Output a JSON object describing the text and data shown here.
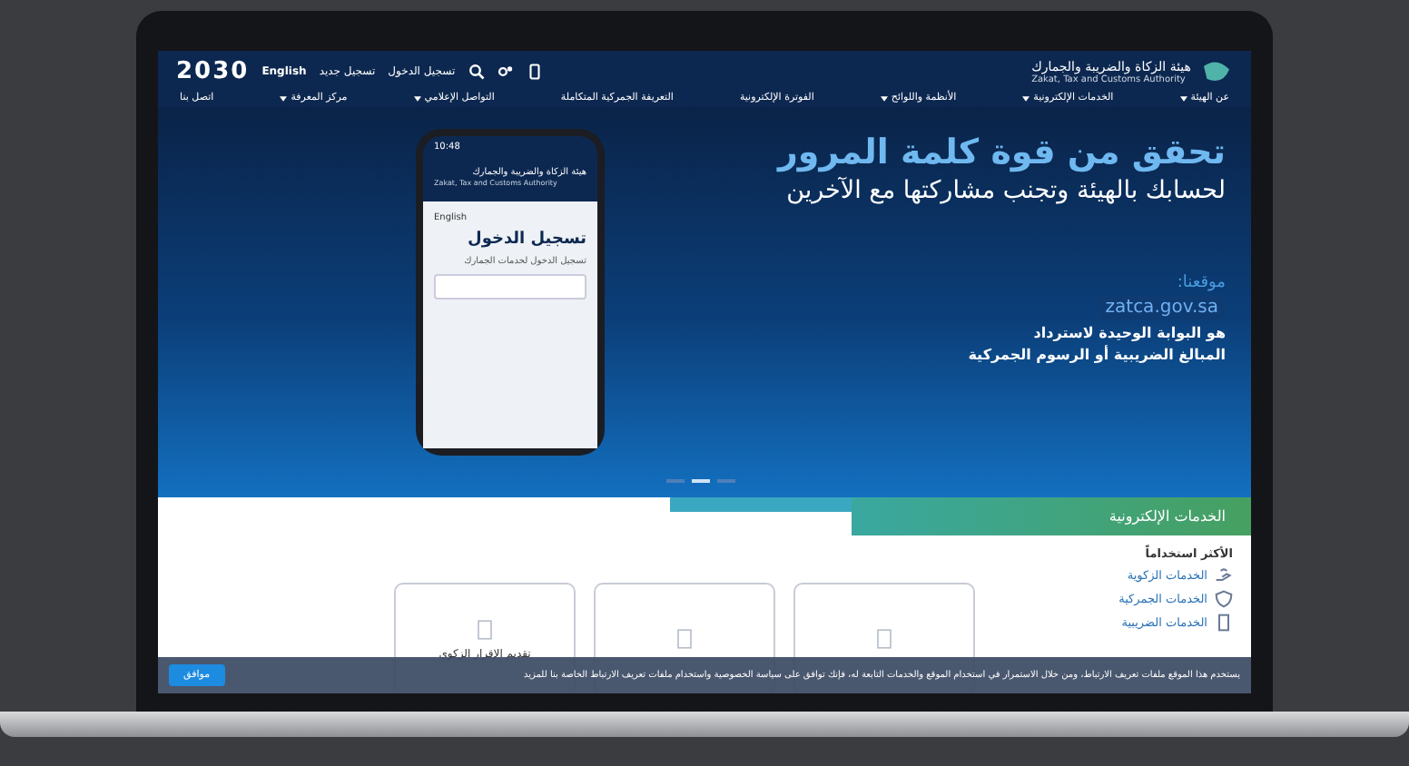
{
  "header": {
    "vision_logo": "2030",
    "language": "English",
    "register": "تسجيل جديد",
    "login": "تسجيل الدخول",
    "org_name_ar": "هيئة الزكاة والضريبة والجمارك",
    "org_name_en": "Zakat, Tax and Customs Authority"
  },
  "nav": [
    {
      "label": "عن الهيئة",
      "has_menu": true
    },
    {
      "label": "الخدمات الإلكترونية",
      "has_menu": true
    },
    {
      "label": "الأنظمة واللوائح",
      "has_menu": true
    },
    {
      "label": "الفوترة الإلكترونية",
      "has_menu": false
    },
    {
      "label": "التعريفة الجمركية المتكاملة",
      "has_menu": false
    },
    {
      "label": "التواصل الإعلامي",
      "has_menu": true
    },
    {
      "label": "مركز المعرفة",
      "has_menu": true
    },
    {
      "label": "اتصل بنا",
      "has_menu": false
    }
  ],
  "hero": {
    "title": "تحقق من قوة كلمة المرور",
    "subtitle": "لحسابك بالهيئة وتجنب مشاركتها مع الآخرين",
    "site_label": "موقعنا:",
    "site": "zatca.gov.sa",
    "desc_lines": [
      "هو البوابة الوحيدة لاسترداد",
      "المبالغ الضريبية أو الرسوم الجمركية"
    ],
    "phone": {
      "time": "10:48",
      "org_name_ar": "هيئة الزكاة والضريبة والجمارك",
      "org_name_en": "Zakat, Tax and Customs Authority",
      "language": "English",
      "title": "تسجيل الدخول",
      "subtitle": "تسجيل الدخول لخدمات الجمارك"
    },
    "dots": [
      {
        "selected": false
      },
      {
        "selected": true
      },
      {
        "selected": false
      }
    ]
  },
  "services": {
    "tab": "الخدمات الإلكترونية",
    "most_used": "الأكثر استخداماً",
    "items": [
      {
        "label": "الخدمات الزكوية",
        "kind": "hand"
      },
      {
        "label": "الخدمات الجمركية",
        "kind": "shield"
      },
      {
        "label": "الخدمات الضريبية",
        "kind": "doc"
      }
    ],
    "cards": [
      {
        "kind": "document"
      },
      {
        "kind": "document"
      },
      {
        "kind": "document",
        "label": "تقديم الإقرار الزكوي"
      }
    ]
  },
  "cookie": {
    "text": "يستخدم هذا الموقع ملفات تعريف الارتباط، ومن خلال الاستمرار في استخدام الموقع والخدمات التابعة له، فإنك توافق على سياسة الخصوصية واستخدام ملفات تعريف الارتباط الخاصة بنا للمزيد",
    "button": "موافق"
  }
}
